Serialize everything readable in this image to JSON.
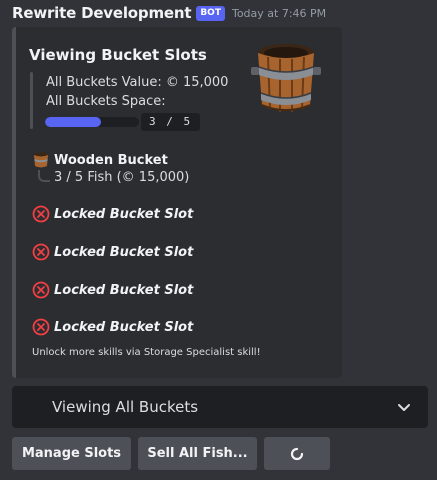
{
  "message": {
    "author": "Rewrite Development",
    "badge": "BOT",
    "timestamp": "Today at 7:46 PM"
  },
  "embed": {
    "title": "Viewing Bucket Slots",
    "value_line": "All Buckets Value: © 15,000",
    "space_line": "All Buckets Space:",
    "space_progress": 0.6,
    "space_count": "3 / 5",
    "owned_slot": {
      "name": "Wooden Bucket",
      "detail": "3 / 5 Fish (© 15,000)"
    },
    "locked_slots": [
      "Locked Bucket Slot",
      "Locked Bucket Slot",
      "Locked Bucket Slot",
      "Locked Bucket Slot"
    ],
    "footer": "Unlock more skills via Storage Specialist skill!",
    "accent_color": "#4e5058"
  },
  "select_menu": {
    "selected": "Viewing All Buckets"
  },
  "buttons": {
    "manage": "Manage Slots",
    "sell": "Sell All Fish...",
    "refresh_icon": "refresh-icon"
  },
  "colors": {
    "progress_fill": "#5865f2",
    "badge": "#5865f2",
    "locked_icon": "#f23f43"
  }
}
